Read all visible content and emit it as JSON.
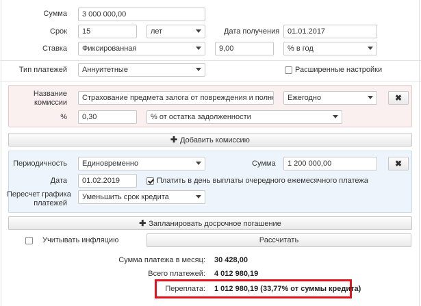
{
  "form": {
    "sum_label": "Сумма",
    "sum_value": "3 000 000,00",
    "term_label": "Срок",
    "term_value": "15",
    "term_unit": "лет",
    "date_label": "Дата получения",
    "date_value": "01.01.2017",
    "rate_label": "Ставка",
    "rate_type": "Фиксированная",
    "rate_value": "9,00",
    "rate_unit": "% в год",
    "payment_type_label": "Тип платежей",
    "payment_type_value": "Аннуитетные",
    "advanced_label": "Расширенные настройки"
  },
  "commission": {
    "name_label_1": "Название",
    "name_label_2": "комиссии",
    "name_value": "Страхование предмета залога от повреждения и полного ун",
    "frequency": "Ежегодно",
    "percent_label": "%",
    "percent_value": "0,30",
    "percent_base": "% от остатка задолженности",
    "add_label": "Добавить комиссию"
  },
  "early": {
    "periodicity_label": "Периодичность",
    "periodicity_value": "Единовременно",
    "sum_label": "Сумма",
    "sum_value": "1 200 000,00",
    "date_label": "Дата",
    "date_value": "01.02.2019",
    "pay_on_day_label": "Платить в день выплаты очередного ежемесячного платежа",
    "recalc_label_1": "Пересчет графика",
    "recalc_label_2": "платежей",
    "recalc_value": "Уменьшить срок кредита",
    "add_label": "Запланировать досрочное погашение"
  },
  "inflation_label": "Учитывать инфляцию",
  "calculate_label": "Рассчитать",
  "results": {
    "monthly_label": "Сумма платежа в месяц:",
    "monthly_value": "30 428,00",
    "total_label": "Всего платежей:",
    "total_value": "4 012 980,19",
    "overpay_label": "Переплата:",
    "overpay_value": "1 012 980,19 (33,77% от суммы кредита)"
  },
  "colors": {
    "highlight": "#e3121b",
    "commission_panel": "#fbf0f0",
    "early_panel": "#edf4fb"
  }
}
